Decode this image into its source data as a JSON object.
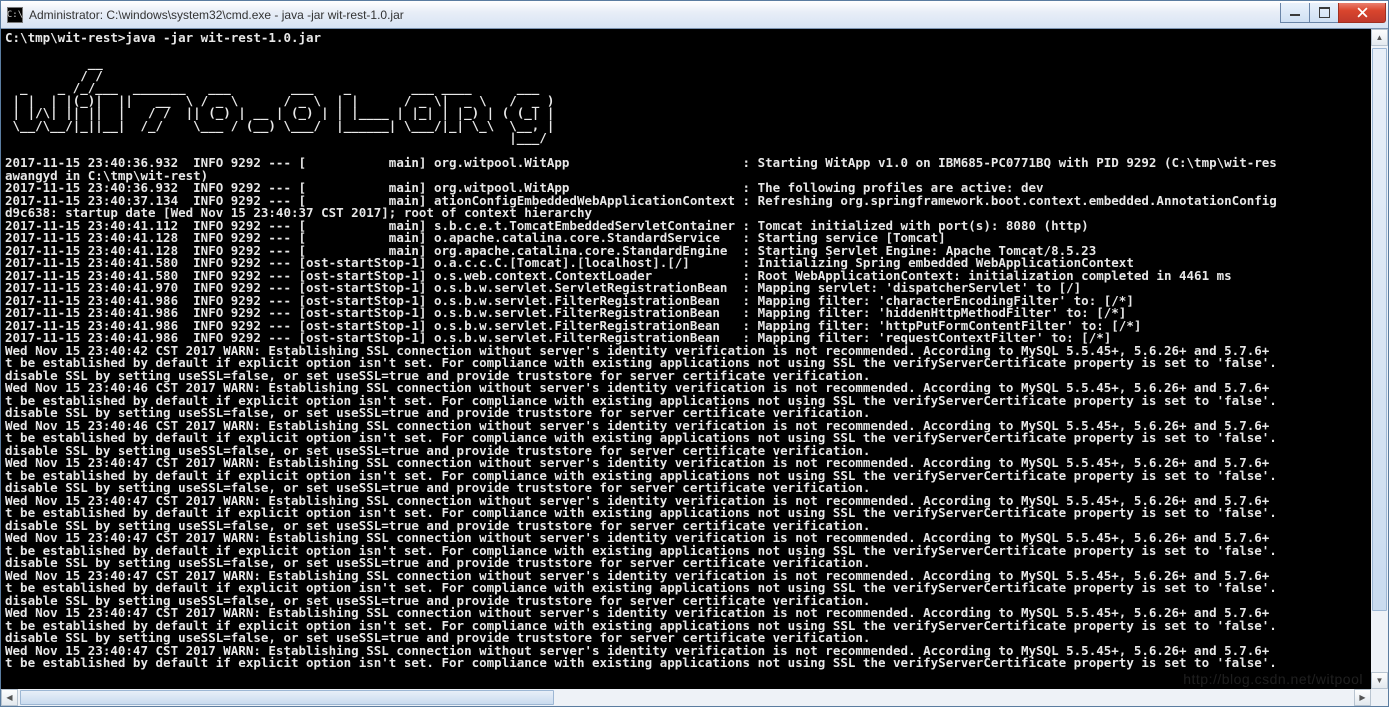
{
  "window": {
    "icon_text": "C:\\",
    "title": "Administrator: C:\\windows\\system32\\cmd.exe - java  -jar wit-rest-1.0.jar"
  },
  "prompt_line": "C:\\tmp\\wit-rest>java -jar wit-rest-1.0.jar",
  "banner": "           __\n          / /\n  _    _ /_/___  _______   ___        ___    _        ___ ____      ___\n | |  | |(_)|  ||   __  \\ / _ \\      / _ \\  | |      / _ \\|  _ \\   /  _ )\n | |/\\| || ||  |   / /  || (_) | __ | (_) | | |____ | |_| | |_) | ( (_| |\n \\__/\\__/|_||__|  /_/    \\___ / (__) \\___/  |______| \\___/|_| \\_\\  \\__, |\n                                                                   |___/\n",
  "log_lines": [
    "2017-11-15 23:40:36.932  INFO 9292 --- [           main] org.witpool.WitApp                       : Starting WitApp v1.0 on IBM685-PC0771BQ with PID 9292 (C:\\tmp\\wit-res",
    "awangyd in C:\\tmp\\wit-rest)",
    "2017-11-15 23:40:36.932  INFO 9292 --- [           main] org.witpool.WitApp                       : The following profiles are active: dev",
    "2017-11-15 23:40:37.134  INFO 9292 --- [           main] ationConfigEmbeddedWebApplicationContext : Refreshing org.springframework.boot.context.embedded.AnnotationConfig",
    "d9c638: startup date [Wed Nov 15 23:40:37 CST 2017]; root of context hierarchy",
    "2017-11-15 23:40:41.112  INFO 9292 --- [           main] s.b.c.e.t.TomcatEmbeddedServletContainer : Tomcat initialized with port(s): 8080 (http)",
    "2017-11-15 23:40:41.128  INFO 9292 --- [           main] o.apache.catalina.core.StandardService   : Starting service [Tomcat]",
    "2017-11-15 23:40:41.128  INFO 9292 --- [           main] org.apache.catalina.core.StandardEngine  : Starting Servlet Engine: Apache Tomcat/8.5.23",
    "2017-11-15 23:40:41.580  INFO 9292 --- [ost-startStop-1] o.a.c.c.C.[Tomcat].[localhost].[/]       : Initializing Spring embedded WebApplicationContext",
    "2017-11-15 23:40:41.580  INFO 9292 --- [ost-startStop-1] o.s.web.context.ContextLoader            : Root WebApplicationContext: initialization completed in 4461 ms",
    "2017-11-15 23:40:41.970  INFO 9292 --- [ost-startStop-1] o.s.b.w.servlet.ServletRegistrationBean  : Mapping servlet: 'dispatcherServlet' to [/]",
    "2017-11-15 23:40:41.986  INFO 9292 --- [ost-startStop-1] o.s.b.w.servlet.FilterRegistrationBean   : Mapping filter: 'characterEncodingFilter' to: [/*]",
    "2017-11-15 23:40:41.986  INFO 9292 --- [ost-startStop-1] o.s.b.w.servlet.FilterRegistrationBean   : Mapping filter: 'hiddenHttpMethodFilter' to: [/*]",
    "2017-11-15 23:40:41.986  INFO 9292 --- [ost-startStop-1] o.s.b.w.servlet.FilterRegistrationBean   : Mapping filter: 'httpPutFormContentFilter' to: [/*]",
    "2017-11-15 23:40:41.986  INFO 9292 --- [ost-startStop-1] o.s.b.w.servlet.FilterRegistrationBean   : Mapping filter: 'requestContextFilter' to: [/*]",
    "Wed Nov 15 23:40:42 CST 2017 WARN: Establishing SSL connection without server's identity verification is not recommended. According to MySQL 5.5.45+, 5.6.26+ and 5.7.6+",
    "t be established by default if explicit option isn't set. For compliance with existing applications not using SSL the verifyServerCertificate property is set to 'false'.",
    "disable SSL by setting useSSL=false, or set useSSL=true and provide truststore for server certificate verification.",
    "Wed Nov 15 23:40:46 CST 2017 WARN: Establishing SSL connection without server's identity verification is not recommended. According to MySQL 5.5.45+, 5.6.26+ and 5.7.6+",
    "t be established by default if explicit option isn't set. For compliance with existing applications not using SSL the verifyServerCertificate property is set to 'false'.",
    "disable SSL by setting useSSL=false, or set useSSL=true and provide truststore for server certificate verification.",
    "Wed Nov 15 23:40:46 CST 2017 WARN: Establishing SSL connection without server's identity verification is not recommended. According to MySQL 5.5.45+, 5.6.26+ and 5.7.6+",
    "t be established by default if explicit option isn't set. For compliance with existing applications not using SSL the verifyServerCertificate property is set to 'false'.",
    "disable SSL by setting useSSL=false, or set useSSL=true and provide truststore for server certificate verification.",
    "Wed Nov 15 23:40:47 CST 2017 WARN: Establishing SSL connection without server's identity verification is not recommended. According to MySQL 5.5.45+, 5.6.26+ and 5.7.6+",
    "t be established by default if explicit option isn't set. For compliance with existing applications not using SSL the verifyServerCertificate property is set to 'false'.",
    "disable SSL by setting useSSL=false, or set useSSL=true and provide truststore for server certificate verification.",
    "Wed Nov 15 23:40:47 CST 2017 WARN: Establishing SSL connection without server's identity verification is not recommended. According to MySQL 5.5.45+, 5.6.26+ and 5.7.6+",
    "t be established by default if explicit option isn't set. For compliance with existing applications not using SSL the verifyServerCertificate property is set to 'false'.",
    "disable SSL by setting useSSL=false, or set useSSL=true and provide truststore for server certificate verification.",
    "Wed Nov 15 23:40:47 CST 2017 WARN: Establishing SSL connection without server's identity verification is not recommended. According to MySQL 5.5.45+, 5.6.26+ and 5.7.6+",
    "t be established by default if explicit option isn't set. For compliance with existing applications not using SSL the verifyServerCertificate property is set to 'false'.",
    "disable SSL by setting useSSL=false, or set useSSL=true and provide truststore for server certificate verification.",
    "Wed Nov 15 23:40:47 CST 2017 WARN: Establishing SSL connection without server's identity verification is not recommended. According to MySQL 5.5.45+, 5.6.26+ and 5.7.6+",
    "t be established by default if explicit option isn't set. For compliance with existing applications not using SSL the verifyServerCertificate property is set to 'false'.",
    "disable SSL by setting useSSL=false, or set useSSL=true and provide truststore for server certificate verification.",
    "Wed Nov 15 23:40:47 CST 2017 WARN: Establishing SSL connection without server's identity verification is not recommended. According to MySQL 5.5.45+, 5.6.26+ and 5.7.6+",
    "t be established by default if explicit option isn't set. For compliance with existing applications not using SSL the verifyServerCertificate property is set to 'false'.",
    "disable SSL by setting useSSL=false, or set useSSL=true and provide truststore for server certificate verification.",
    "Wed Nov 15 23:40:47 CST 2017 WARN: Establishing SSL connection without server's identity verification is not recommended. According to MySQL 5.5.45+, 5.6.26+ and 5.7.6+",
    "t be established by default if explicit option isn't set. For compliance with existing applications not using SSL the verifyServerCertificate property is set to 'false'."
  ],
  "watermark": "http://blog.csdn.net/witpool"
}
